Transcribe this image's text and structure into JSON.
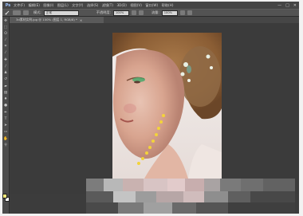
{
  "app": {
    "logo": "Ps",
    "menu": [
      "文件(F)",
      "编辑(E)",
      "图像(I)",
      "图层(L)",
      "文字(Y)",
      "选择(S)",
      "滤镜(T)",
      "3D(D)",
      "视图(V)",
      "窗口(W)",
      "帮助(H)"
    ],
    "window_controls": [
      "—",
      "□",
      "✕"
    ]
  },
  "options": {
    "mode_label": "模式:",
    "mode_value": "正常",
    "opacity_label": "不透明度:",
    "opacity_value": "100%",
    "flow_label": "流量:",
    "flow_value": "100%"
  },
  "document": {
    "tab_title": "3d素材实例.jpg @ 100% (图层 1, RGB/8) *",
    "close_glyph": "✕"
  },
  "toolbar": {
    "tools": [
      "move-icon",
      "marquee-icon",
      "lasso-icon",
      "quick-select-icon",
      "crop-icon",
      "eyedropper-icon",
      "healing-brush-icon",
      "brush-icon",
      "clone-stamp-icon",
      "history-brush-icon",
      "eraser-icon",
      "gradient-icon",
      "blur-icon",
      "dodge-icon",
      "pen-icon",
      "type-icon",
      "path-select-icon",
      "shape-icon",
      "hand-icon",
      "zoom-icon"
    ],
    "foreground_color": "#f2e87a",
    "background_color": "#ffffff"
  },
  "colors": {
    "ui_dark": "#3c3c3c",
    "brush_dots": "#f3d33a"
  }
}
